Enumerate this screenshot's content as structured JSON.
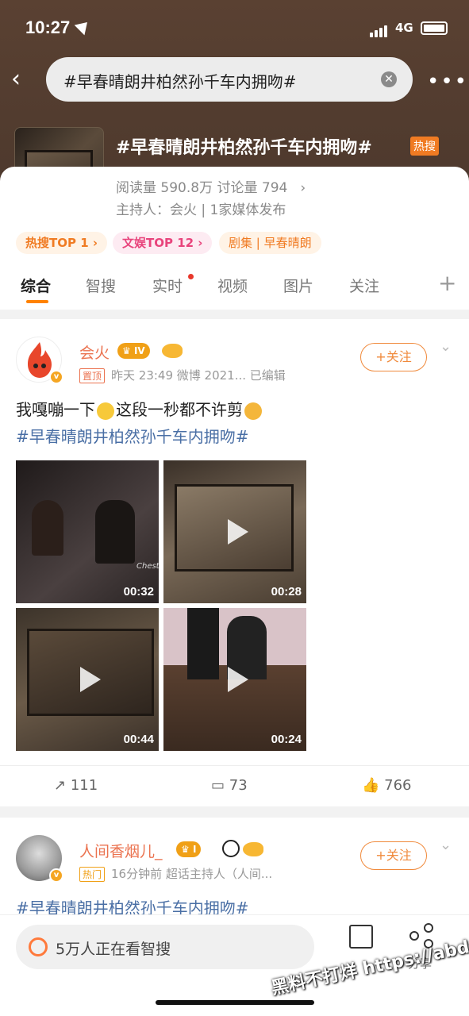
{
  "status": {
    "time": "10:27",
    "network": "4G"
  },
  "search": {
    "query": "#早春晴朗井柏然孙千车内拥吻#"
  },
  "topic": {
    "title": "#早春晴朗井柏然孙千车内拥吻#",
    "hot_label": "热搜",
    "stats": "阅读量 590.8万  讨论量 794",
    "host": "主持人：会火 | 1家媒体发布",
    "chips": [
      "热搜TOP 1 ›",
      "文娱TOP 12 ›",
      "剧集 | 早春晴朗"
    ]
  },
  "tabs": [
    "综合",
    "智搜",
    "实时",
    "视频",
    "图片",
    "关注"
  ],
  "post1": {
    "username": "会火",
    "level": "IV",
    "pin_label": "置顶",
    "meta": "昨天 23:49  微博 2021...  已编辑",
    "follow_label": "+关注",
    "text_a": "我嘎嘣一下",
    "text_b": "这段一秒都不许剪",
    "hashtag": "#早春晴朗井柏然孙千车内拥吻#",
    "videos": [
      {
        "duration": "00:32",
        "watermark": "Chest"
      },
      {
        "duration": "00:28"
      },
      {
        "duration": "00:44"
      },
      {
        "duration": "00:24"
      }
    ],
    "reposts": "111",
    "comments": "73",
    "likes": "766"
  },
  "post2": {
    "username": "人间香烟儿_",
    "level": "I",
    "hot_label": "热门",
    "meta": "16分钟前  超话主持人（人间...",
    "follow_label": "+关注",
    "hashtag": "#早春晴朗井柏然孙千车内拥吻#"
  },
  "bottom": {
    "ask_text": "5万人正在看智搜",
    "share_label": "分享"
  },
  "overlay_watermark": "黑料不打烊 https://abdy9.com",
  "colors": {
    "accent": "#ff8200",
    "username": "#eb7350",
    "hashtag": "#4a6fa5"
  }
}
